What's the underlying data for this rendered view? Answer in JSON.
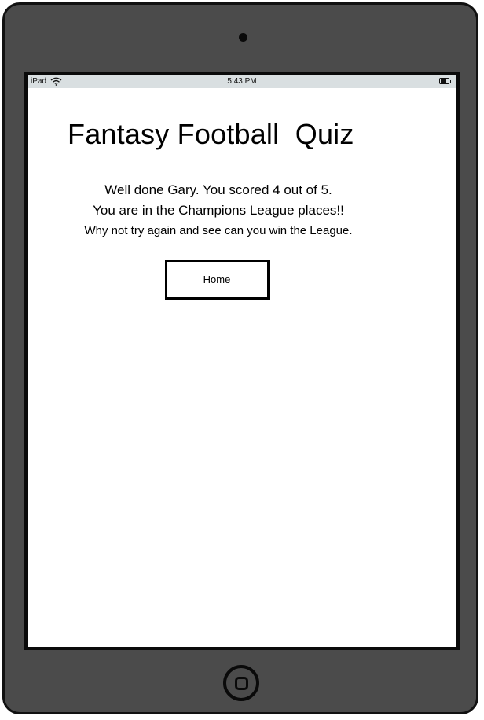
{
  "status_bar": {
    "device": "iPad",
    "time": "5:43 PM",
    "icons": [
      "wifi-icon",
      "battery-icon"
    ]
  },
  "quiz": {
    "title": "Fantasy Football  Quiz",
    "score_line": "Well done Gary. You scored 4 out of 5.",
    "result_line": "You are in the Champions League places!!",
    "encourage_line": "Why not try again and see can you win the League."
  },
  "actions": {
    "home_label": "Home"
  },
  "colors": {
    "device_body": "#4b4b4b",
    "status_bar": "#d9dfe1",
    "screen": "#ffffff",
    "text": "#000000"
  }
}
